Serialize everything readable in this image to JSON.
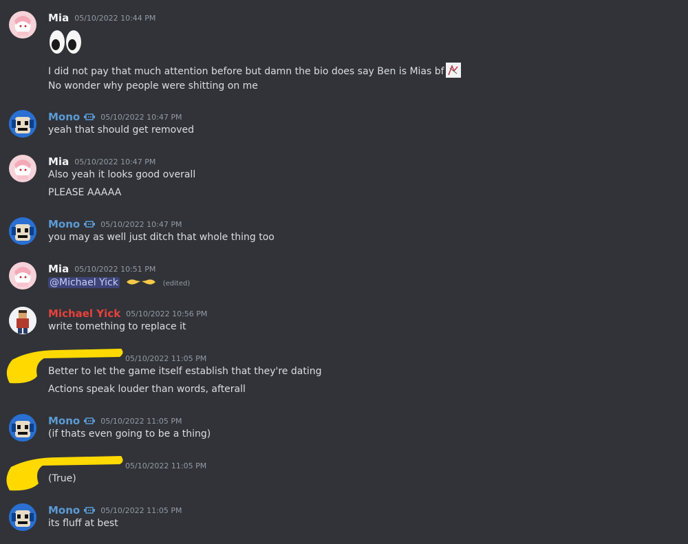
{
  "messages": [
    {
      "user": "Mia",
      "time": "05/10/2022 10:44 PM",
      "emoji_line": "👀",
      "lines": [
        "I did not pay that much attention before but damn the bio does say Ben is Mias bf",
        "No wonder why people were shitting on me"
      ]
    },
    {
      "user": "Mono",
      "time": "05/10/2022 10:47 PM",
      "lines": [
        "yeah that should get removed"
      ]
    },
    {
      "user": "Mia",
      "time": "05/10/2022 10:47 PM",
      "lines": [
        "Also yeah it looks good overall",
        "PLEASE AAAAA"
      ]
    },
    {
      "user": "Mono",
      "time": "05/10/2022 10:47 PM",
      "lines": [
        "you may as well just ditch that whole thing too"
      ]
    },
    {
      "user": "Mia",
      "time": "05/10/2022 10:51 PM",
      "mention": "@Michael Yick",
      "edited": "(edited)"
    },
    {
      "user": "Michael Yick",
      "time": "05/10/2022 10:56 PM",
      "lines": [
        "write tomething to replace it"
      ]
    },
    {
      "user": "",
      "time": "05/10/2022 11:05 PM",
      "lines": [
        "Better to let the game itself establish that they're dating",
        "Actions speak louder than words, afterall"
      ]
    },
    {
      "user": "Mono",
      "time": "05/10/2022 11:05 PM",
      "lines": [
        "(if thats even going to be a thing)"
      ]
    },
    {
      "user": "",
      "time": "05/10/2022 11:05 PM",
      "lines": [
        "(True)"
      ]
    },
    {
      "user": "Mono",
      "time": "05/10/2022 11:05 PM",
      "lines": [
        "its fluff at best"
      ]
    }
  ],
  "colors": {
    "background": "#313338",
    "mono_name": "#5b9bd5",
    "michael_name": "#e8413c",
    "redaction": "#ffd900"
  }
}
